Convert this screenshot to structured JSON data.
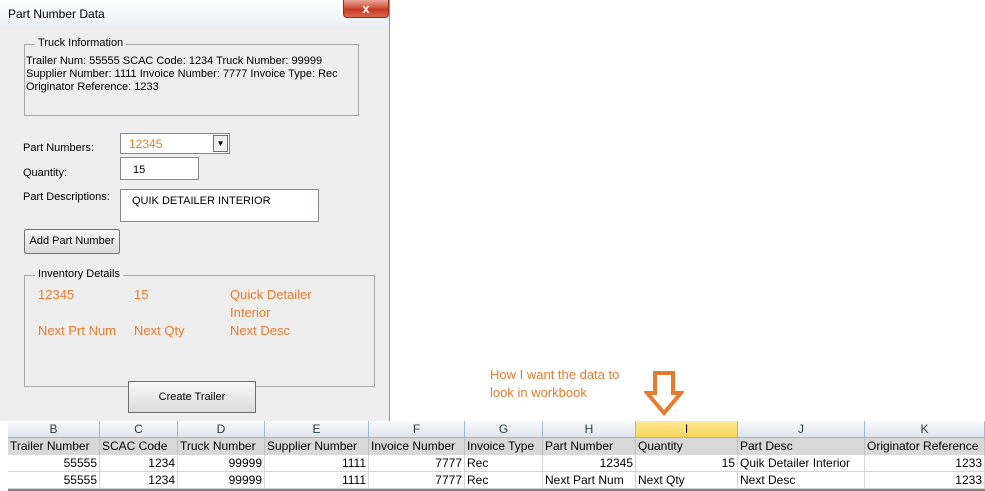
{
  "window": {
    "title": "Part Number Data",
    "close_glyph": "x",
    "close_icon": "close-icon"
  },
  "truck_info": {
    "legend": "Truck Information",
    "text": "Trailer Num: 55555 SCAC Code: 1234 Truck Number: 99999  Supplier Number: 1111 Invoice Number: 7777 Invoice Type: Rec Originator Reference: 1233"
  },
  "form": {
    "part_numbers_label": "Part Numbers:",
    "part_numbers_value": "12345",
    "quantity_label": "Quantity:",
    "quantity_value": "15",
    "part_descriptions_label": "Part Descriptions:",
    "part_descriptions_value": "QUIK DETAILER INTERIOR",
    "add_button": "Add Part Number",
    "dropdown_glyph": "▼"
  },
  "inventory": {
    "legend": "Inventory Details",
    "rows": [
      [
        "12345",
        "15",
        "Quick Detailer Interior"
      ],
      [
        "Next Prt Num",
        "Next Qty",
        "Next Desc"
      ]
    ]
  },
  "create_button": "Create Trailer",
  "annotation": {
    "text": "How I want the data to look in workbook",
    "icon": "arrow-down-icon"
  },
  "colors": {
    "accent_orange": "#e87b2e",
    "close_red": "#c7381f",
    "active_column": "#f9d65b"
  },
  "sheet": {
    "column_letters": [
      "B",
      "C",
      "D",
      "E",
      "F",
      "G",
      "H",
      "I",
      "J",
      "K"
    ],
    "active_column": "I",
    "headers": [
      "Trailer Number",
      "SCAC Code",
      "Truck Number",
      "Supplier Number",
      "Invoice Number",
      "Invoice Type",
      "Part Number",
      "Quantity",
      "Part Desc",
      "Originator Reference"
    ],
    "rows": [
      [
        "55555",
        "1234",
        "99999",
        "1111",
        "7777",
        "Rec",
        "12345",
        "15",
        "Quik Detailer Interior",
        "1233"
      ],
      [
        "55555",
        "1234",
        "99999",
        "1111",
        "7777",
        "Rec",
        "Next Part Num",
        "Next Qty",
        "Next Desc",
        "1233"
      ]
    ]
  }
}
